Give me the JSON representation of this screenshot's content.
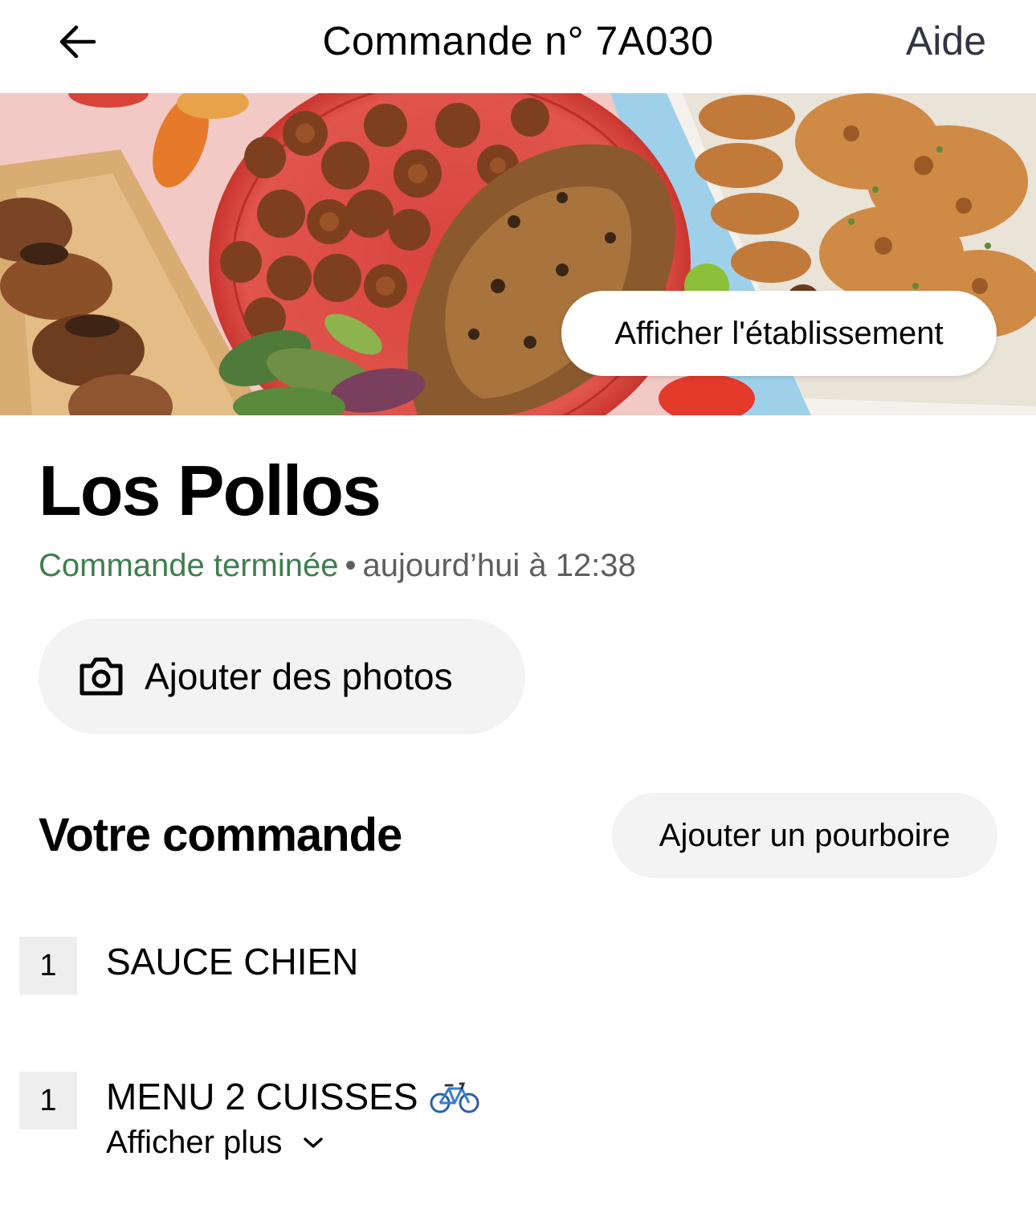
{
  "header": {
    "title": "Commande n° 7A030",
    "help_label": "Aide"
  },
  "hero": {
    "view_store_label": "Afficher l'établissement"
  },
  "store": {
    "name": "Los Pollos",
    "status_text": "Commande terminée",
    "separator": "•",
    "time_text": "aujourd’hui à 12:38",
    "status_color": "#3f7d4e"
  },
  "photos": {
    "label": "Ajouter des photos"
  },
  "order": {
    "section_title": "Votre commande",
    "tip_label": "Ajouter un pourboire",
    "items": [
      {
        "qty": "1",
        "name": "SAUCE CHIEN"
      },
      {
        "qty": "1",
        "name": "MENU 2 CUISSES",
        "icon": "bicycle-icon",
        "more_label": "Afficher plus"
      }
    ]
  }
}
